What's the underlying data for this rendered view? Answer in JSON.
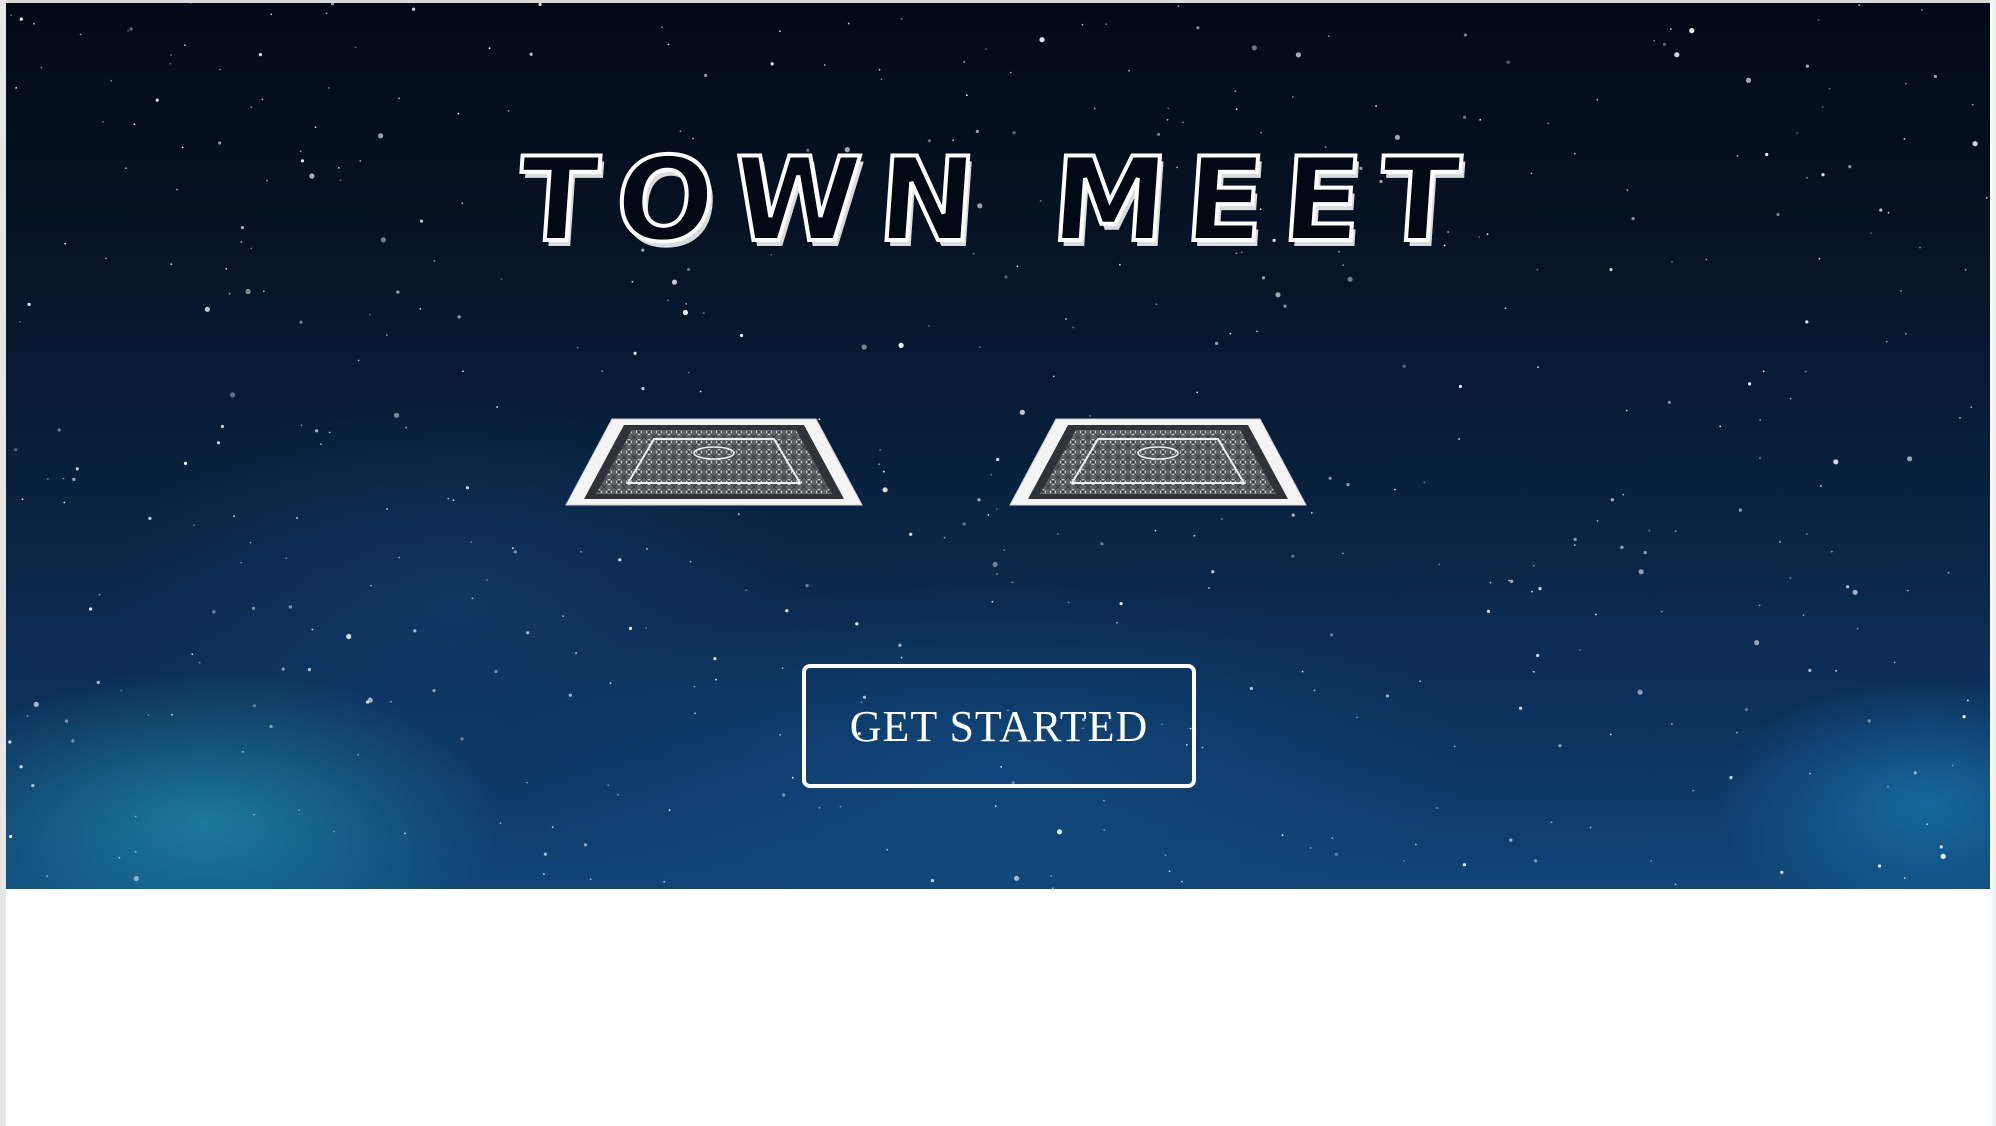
{
  "hero": {
    "title": "TOWN MEET",
    "cta_label": "GET STARTED"
  },
  "cards": [
    {
      "name": "card-back-left"
    },
    {
      "name": "card-back-right"
    }
  ],
  "colors": {
    "sky_top": "#030a16",
    "sky_bottom": "#0f4676",
    "nebula": "#28aabe",
    "text": "#ffffff"
  },
  "icons": [
    "card-back-icon",
    "card-back-icon"
  ]
}
